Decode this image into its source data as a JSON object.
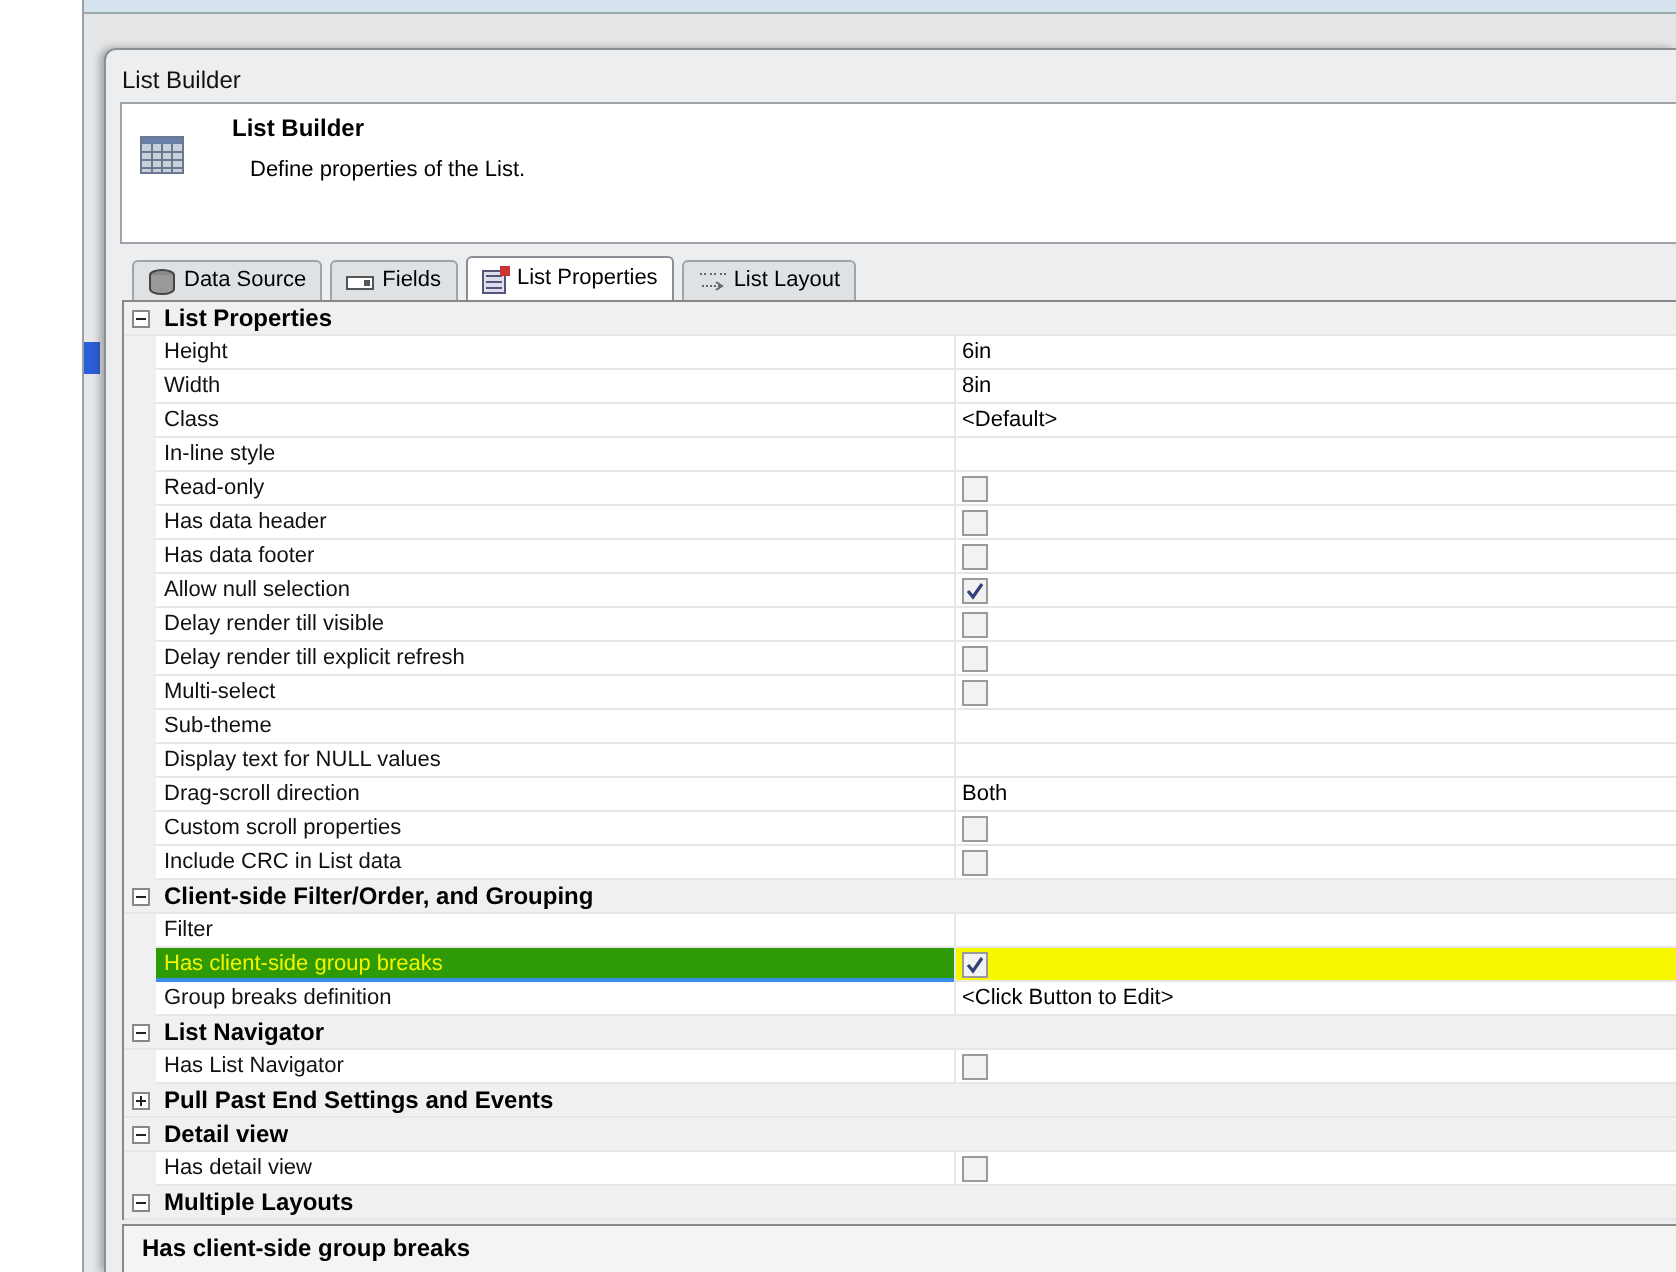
{
  "window": {
    "title": "List Builder"
  },
  "header": {
    "title": "List Builder",
    "subtitle": "Define properties of the List."
  },
  "tabs": [
    {
      "label": "Data Source",
      "selected": false
    },
    {
      "label": "Fields",
      "selected": false
    },
    {
      "label": "List Properties",
      "selected": true
    },
    {
      "label": "List Layout",
      "selected": false
    }
  ],
  "grid": [
    {
      "category": "List Properties",
      "expanded": true,
      "items": [
        {
          "label": "Height",
          "kind": "text",
          "value": "6in",
          "selected": false
        },
        {
          "label": "Width",
          "kind": "text",
          "value": "8in",
          "selected": false
        },
        {
          "label": "Class",
          "kind": "text",
          "value": "<Default>",
          "selected": false
        },
        {
          "label": "In-line style",
          "kind": "text",
          "selected": false
        },
        {
          "label": "Read-only",
          "kind": "check",
          "checked": false,
          "selected": false
        },
        {
          "label": "Has data header",
          "kind": "check",
          "checked": false,
          "selected": false
        },
        {
          "label": "Has data footer",
          "kind": "check",
          "checked": false,
          "selected": false
        },
        {
          "label": "Allow null selection",
          "kind": "check",
          "checked": true,
          "selected": false
        },
        {
          "label": "Delay render till visible",
          "kind": "check",
          "checked": false,
          "selected": false
        },
        {
          "label": "Delay render till explicit refresh",
          "kind": "check",
          "checked": false,
          "selected": false
        },
        {
          "label": "Multi-select",
          "kind": "check",
          "checked": false,
          "selected": false
        },
        {
          "label": "Sub-theme",
          "kind": "text",
          "selected": false
        },
        {
          "label": "Display text for NULL values",
          "kind": "text",
          "selected": false
        },
        {
          "label": "Drag-scroll direction",
          "kind": "text",
          "value": "Both",
          "selected": false
        },
        {
          "label": "Custom scroll properties",
          "kind": "check",
          "checked": false,
          "selected": false
        },
        {
          "label": "Include CRC in List data",
          "kind": "check",
          "checked": false,
          "selected": false
        }
      ]
    },
    {
      "category": "Client-side Filter/Order,  and Grouping",
      "expanded": true,
      "items": [
        {
          "label": "Filter",
          "kind": "text",
          "selected": false
        },
        {
          "label": "Has client-side group breaks",
          "kind": "check",
          "checked": true,
          "selected": true
        },
        {
          "label": "Group breaks definition",
          "kind": "text",
          "value": "<Click Button to Edit>",
          "selected": false
        }
      ]
    },
    {
      "category": "List Navigator",
      "expanded": true,
      "items": [
        {
          "label": "Has List Navigator",
          "kind": "check",
          "checked": false,
          "selected": false
        }
      ]
    },
    {
      "category": "Pull Past End Settings and Events",
      "expanded": false
    },
    {
      "category": "Detail view",
      "expanded": true,
      "items": [
        {
          "label": "Has detail view",
          "kind": "check",
          "checked": false,
          "selected": false
        }
      ]
    },
    {
      "category": "Multiple Layouts",
      "expanded": true
    }
  ],
  "status_bar": {
    "text": "Has client-side group breaks"
  }
}
